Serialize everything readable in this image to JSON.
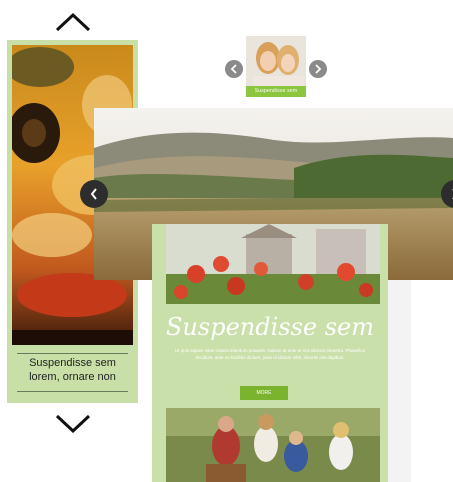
{
  "vertical_carousel": {
    "caption_line1": "Suspendisse sem",
    "caption_line2": "lorem, ornare non",
    "up_icon": "chevron-up-icon",
    "down_icon": "chevron-down-icon"
  },
  "thumbnail": {
    "tag_text": "Suspendisse sem"
  },
  "horizontal_carousel": {
    "prev_icon": "chevron-left-icon",
    "next_icon": "chevron-right-icon"
  },
  "newsletter": {
    "title": "Suspendisse sem",
    "body": "Ut quis sapien vitae massa interdum posuere. Nullam at ante et nisl ultrices pharetra. Phasellus tincidunt, ante eu facilisis dictum, justo id dictum nibh, lobortis nisi dapibus.",
    "button_label": "MORE"
  },
  "colors": {
    "panel_green": "#c8e0a8",
    "button_green": "#7ab32e",
    "nav_dark": "#2d2d2d"
  }
}
